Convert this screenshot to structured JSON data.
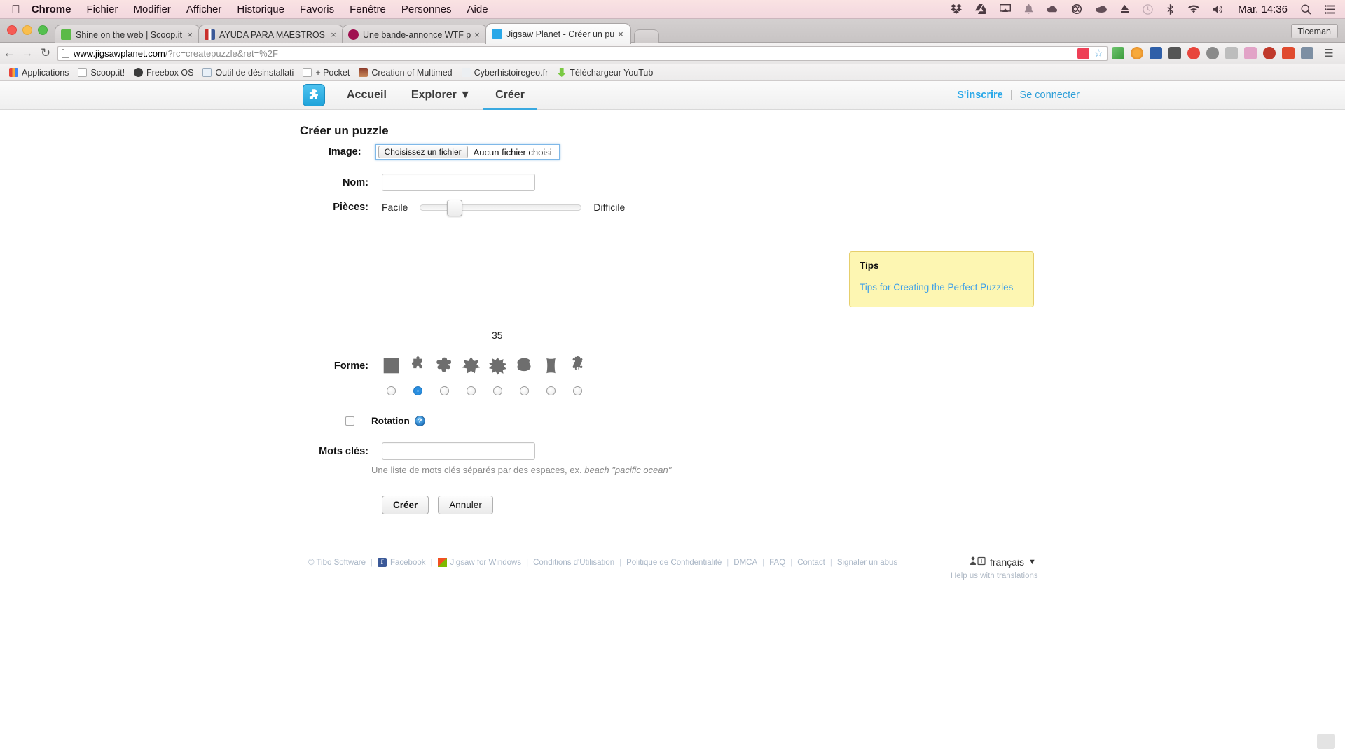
{
  "os_menu": {
    "apple_icon": "apple-icon",
    "items": [
      "Chrome",
      "Fichier",
      "Modifier",
      "Afficher",
      "Historique",
      "Favoris",
      "Fenêtre",
      "Personnes",
      "Aide"
    ],
    "app_name": "Chrome",
    "status_icons": [
      "dropbox-icon",
      "google-drive-icon",
      "airplay-icon",
      "bell-icon",
      "cloud-icon",
      "creative-cloud-icon",
      "cloud-filled-icon",
      "eject-icon",
      "timemachine-icon",
      "bluetooth-icon",
      "wifi-icon",
      "volume-icon"
    ],
    "clock": "Mar. 14:36",
    "search_icon": "search-icon",
    "notification_icon": "notification-center-icon"
  },
  "browser": {
    "profile_label": "Ticeman",
    "tabs": [
      {
        "title": "Shine on the web | Scoop.it",
        "favicon_color": "#5bba47",
        "active": false
      },
      {
        "title": "AYUDA PARA MAESTROS",
        "favicon_color": "#ffffff",
        "active": false
      },
      {
        "title": "Une bande-annonce WTF p",
        "favicon_color": "#a01050",
        "active": false
      },
      {
        "title": "Jigsaw Planet - Créer un pu",
        "favicon_color": "#2aa8e8",
        "active": true
      }
    ],
    "new_tab_label": "",
    "nav": {
      "back": "back-icon",
      "forward": "forward-icon",
      "reload": "reload-icon"
    },
    "url_host": "www.jigsawplanet.com",
    "url_path": "/?rc=createpuzzle&ret=%2F",
    "bookmark_star": "star-icon",
    "menu_icon": "chrome-menu-icon",
    "bookmarks": [
      {
        "label": "Applications",
        "icon": "apps-grid-icon"
      },
      {
        "label": "Scoop.it!",
        "icon": "page-icon"
      },
      {
        "label": "Freebox OS",
        "icon": "freebox-icon"
      },
      {
        "label": "Outil de désinstallati",
        "icon": "java-icon"
      },
      {
        "label": "+ Pocket",
        "icon": "page-icon"
      },
      {
        "label": "Creation of Multimed",
        "icon": "portrait-icon"
      },
      {
        "label": "Cyberhistoiregeo.fr",
        "icon": "owl-icon"
      },
      {
        "label": "Téléchargeur YouTub",
        "icon": "download-icon"
      }
    ]
  },
  "site": {
    "logo": "jigsaw-puzzle-logo",
    "nav": [
      {
        "label": "Accueil",
        "active": false
      },
      {
        "label": "Explorer ▼",
        "active": false
      },
      {
        "label": "Créer",
        "active": true
      }
    ],
    "signup": "S'inscrire",
    "auth_sep": "|",
    "signin": "Se connecter"
  },
  "form": {
    "title": "Créer un puzzle",
    "image_label": "Image:",
    "file_button": "Choisissez un fichier",
    "file_status": "Aucun fichier choisi",
    "name_label": "Nom:",
    "name_value": "",
    "pieces_label": "Pièces:",
    "easy_label": "Facile",
    "hard_label": "Difficile",
    "pieces_count": "35",
    "shape_label": "Forme:",
    "shapes": [
      {
        "name": "square-shape",
        "selected": false
      },
      {
        "name": "classic-jigsaw-shape",
        "selected": true
      },
      {
        "name": "rounded-jigsaw-shape",
        "selected": false
      },
      {
        "name": "star-shape",
        "selected": false
      },
      {
        "name": "spiky-shape",
        "selected": false
      },
      {
        "name": "leaf-shape",
        "selected": false
      },
      {
        "name": "curved-rectangle-shape",
        "selected": false
      },
      {
        "name": "small-jigsaw-shape",
        "selected": false
      }
    ],
    "rotation_label": "Rotation",
    "rotation_checked": false,
    "rotation_help": "?",
    "keywords_label": "Mots clés:",
    "keywords_value": "",
    "keywords_hint_plain": "Une liste de mots clés séparés par des espaces, ex. ",
    "keywords_hint_italic": "beach \"pacific ocean\"",
    "create_button": "Créer",
    "cancel_button": "Annuler"
  },
  "tips": {
    "title": "Tips",
    "link": "Tips for Creating the Perfect Puzzles",
    "bg_color": "#fdf6b2",
    "link_color": "#3ea0e8"
  },
  "footer": {
    "copyright": "© Tibo Software",
    "links": [
      "Facebook",
      "Jigsaw for Windows",
      "Conditions d'Utilisation",
      "Politique de Confidentialité",
      "DMCA",
      "FAQ",
      "Contact",
      "Signaler un abus"
    ],
    "language": "français",
    "language_caret": "▼",
    "translate_help": "Help us with translations"
  }
}
